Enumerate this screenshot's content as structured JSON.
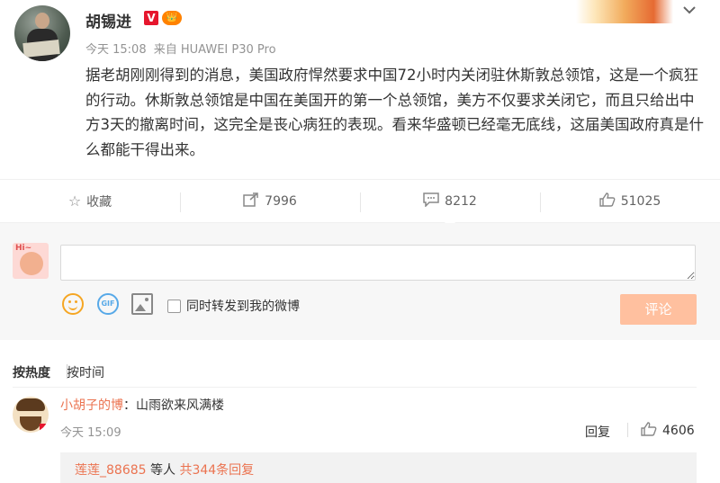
{
  "post": {
    "author": "胡锡进",
    "verified_badge": "V",
    "member_badge": "👑",
    "time": "今天 15:08",
    "source": "来自 HUAWEI P30 Pro",
    "content": "据老胡刚刚得到的消息，美国政府悍然要求中国72小时内关闭驻休斯敦总领馆，这是一个疯狂的行动。休斯敦总领馆是中国在美国开的第一个总领馆，美方不仅要求关闭它，而且只给出中方3天的撤离时间，这完全是丧心病狂的表现。看来华盛顿已经毫无底线，这届美国政府真是什么都能干得出来。"
  },
  "actions": {
    "favorite_label": "收藏",
    "repost_count": "7996",
    "comment_count": "8212",
    "like_count": "51025"
  },
  "compose": {
    "avatar_text": "Hi~",
    "input_value": "",
    "gif_label": "GIF",
    "forward_label": "同时转发到我的微博",
    "submit_label": "评论"
  },
  "sort": {
    "hot_label": "按热度",
    "time_label": "按时间"
  },
  "comments": [
    {
      "user": "小胡子的博",
      "text": "：山雨欲来风满楼",
      "time": "今天 15:09",
      "reply_label": "回复",
      "like_count": "4606",
      "sub_user": "莲莲_88685",
      "sub_text": " 等人 ",
      "sub_total": "共344条回复"
    }
  ],
  "colors": {
    "accent_orange": "#eb7350",
    "submit_disabled": "#ffc09f",
    "verified_red": "#e6162d"
  }
}
